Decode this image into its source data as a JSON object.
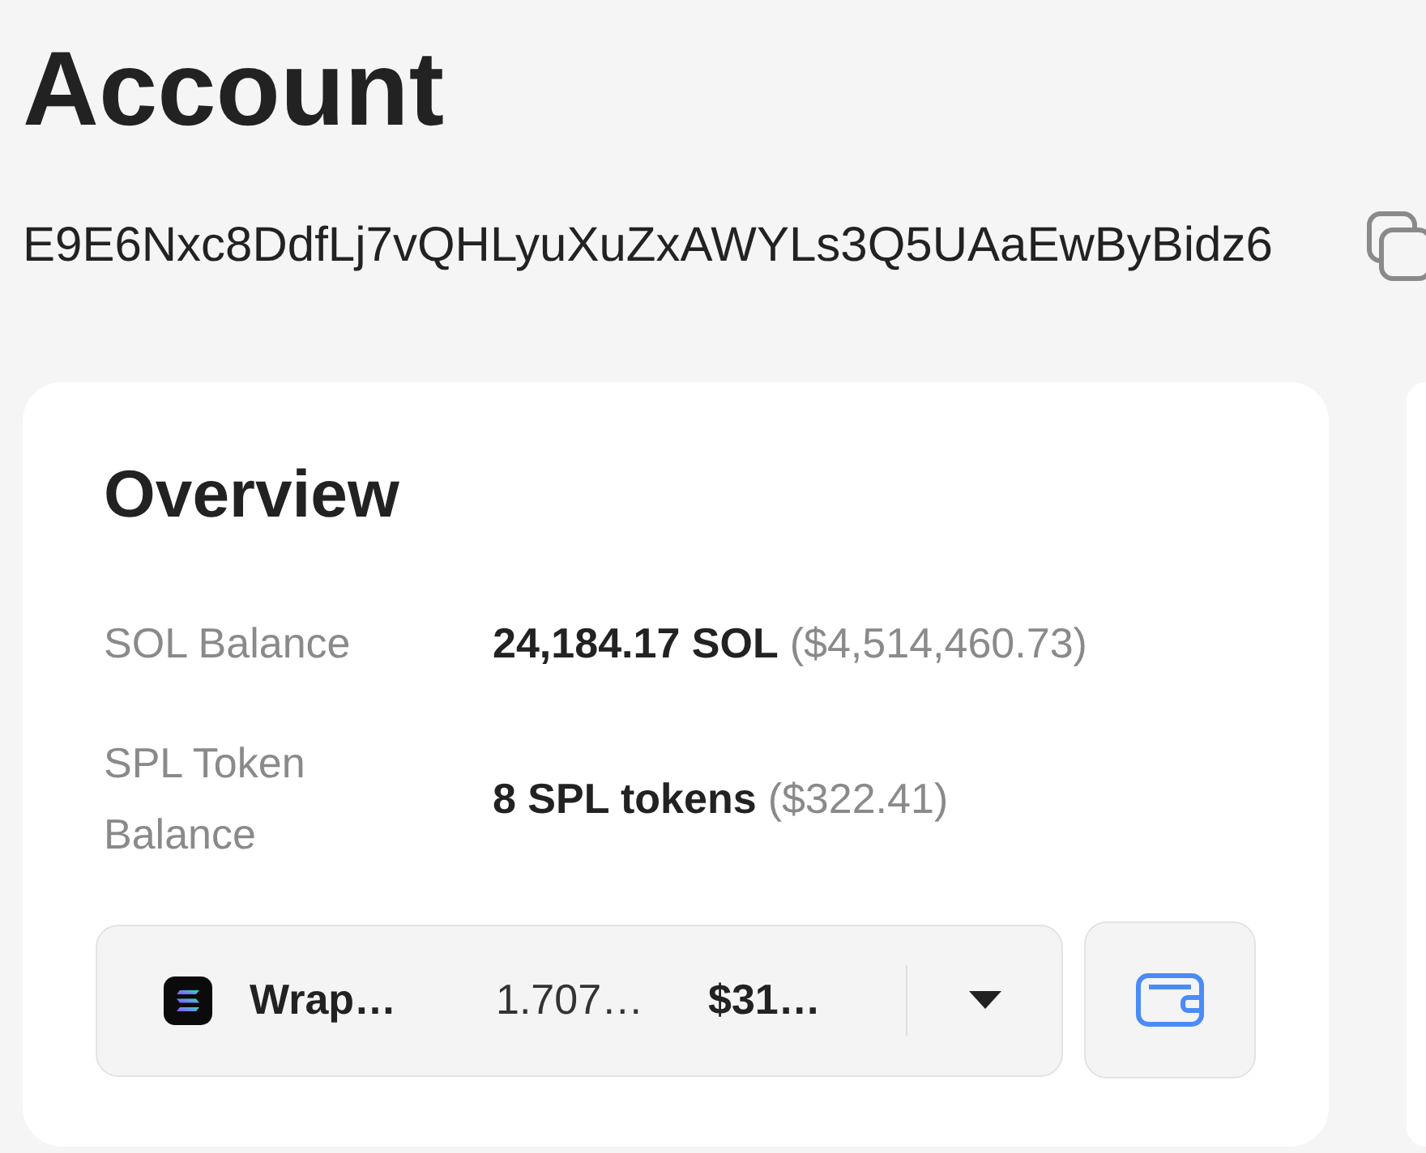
{
  "title": "Account",
  "address": "E9E6Nxc8DdfLj7vQHLyuXuZxAWYLs3Q5UAaEwByBidz6",
  "overview": {
    "title": "Overview",
    "rows": [
      {
        "label": "SOL Balance",
        "amount": "24,184.17 SOL",
        "fiat": "($4,514,460.73)"
      },
      {
        "label": "SPL Token Balance",
        "amount": "8 SPL tokens",
        "fiat": "($322.41)"
      }
    ],
    "token_selector": {
      "name": "Wrap…",
      "amount": "1.707…",
      "value": "$31…"
    }
  }
}
